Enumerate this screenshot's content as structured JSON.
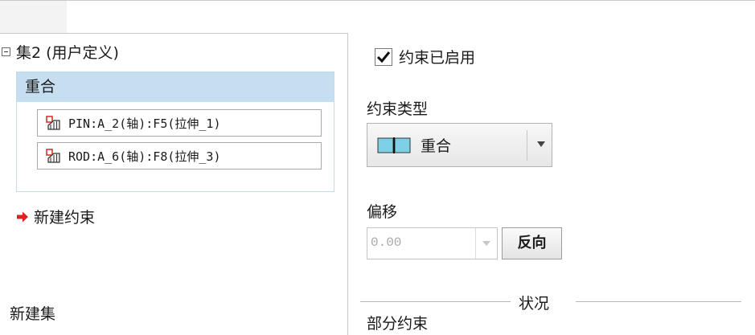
{
  "sets": {
    "set_label": "集2 (用户定义)",
    "constraint": {
      "type_label": "重合",
      "references": [
        {
          "text": "PIN:A_2(轴):F5(拉伸_1)"
        },
        {
          "text": "ROD:A_6(轴):F8(拉伸_3)"
        }
      ]
    },
    "new_constraint_label": "新建约束",
    "new_set_label": "新建集"
  },
  "properties": {
    "enabled_label": "约束已启用",
    "enabled_checked": true,
    "type_heading": "约束类型",
    "type_value": "重合",
    "offset_heading": "偏移",
    "offset_value": "0.00",
    "flip_label": "反向",
    "status_heading": "状况",
    "status_value": "部分约束"
  },
  "colors": {
    "selected_header": "#c5dff0",
    "new_arrow": "#e02020",
    "coincident_icon": "#7ed0e6"
  },
  "icons": {
    "set_toggle": "collapse-icon",
    "reference": "assembly-component-icon",
    "new_constraint": "red-arrow-icon",
    "constraint_type": "coincident-icon",
    "dropdown": "chevron-down-icon"
  }
}
